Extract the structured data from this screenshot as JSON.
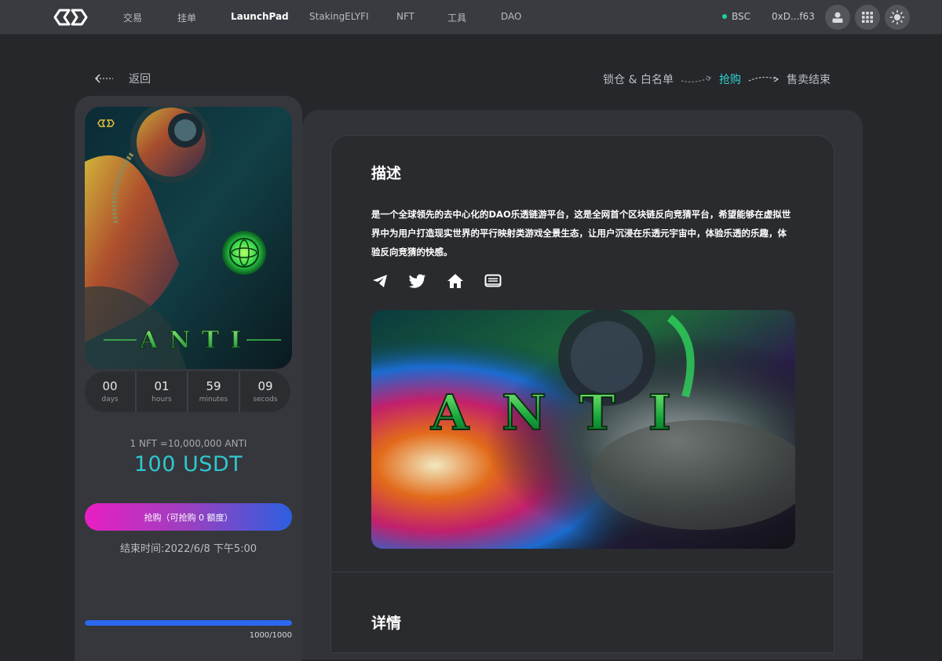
{
  "nav": {
    "items": [
      {
        "label": "交易"
      },
      {
        "label": "挂单"
      },
      {
        "label": "LaunchPad"
      },
      {
        "label": "StakingELYFI"
      },
      {
        "label": "NFT"
      },
      {
        "label": "工具"
      },
      {
        "label": "DAO"
      }
    ],
    "active_label": "LaunchPad",
    "network": "BSC",
    "wallet_address": "0xD...f63",
    "icons": [
      "user-icon",
      "grid-icon",
      "sun-icon"
    ]
  },
  "header": {
    "back_label": "返回",
    "steps": [
      {
        "label": "锁仓 & 白名单",
        "state": "done"
      },
      {
        "label": "抢购",
        "state": "current"
      },
      {
        "label": "售卖结束",
        "state": "upcoming"
      }
    ]
  },
  "sale": {
    "poster_text": "ANTI",
    "countdown": [
      {
        "value": "00",
        "unit": "days"
      },
      {
        "value": "01",
        "unit": "hours"
      },
      {
        "value": "59",
        "unit": "minutes"
      },
      {
        "value": "09",
        "unit": "secods"
      }
    ],
    "rate": "1 NFT =10,000,000 ANTI",
    "price": "100 USDT",
    "buy_label": "抢购（可抢购 0 额度）",
    "end_time": "结束时间:2022/6/8 下午5:00",
    "progress_fraction": 1.0,
    "progress_text": "1000/1000"
  },
  "description": {
    "title": "描述",
    "text": "是一个全球领先的去中心化的DAO乐透链游平台，这是全网首个区块链反向竞猜平台，希望能够在虚拟世界中为用户打造现实世界的平行映射类游戏全景生态，让用户沉浸在乐透元宇宙中，体验乐透的乐趣，体验反向竞猜的快感。",
    "socials": [
      "telegram-icon",
      "twitter-icon",
      "home-icon",
      "book-icon"
    ],
    "banner_text": "ANTI"
  },
  "details": {
    "title": "详情"
  },
  "colors": {
    "accent": "#2fd3d0",
    "price": "#2fc7d0",
    "progress": "#2d68f0",
    "buy_gradient_start": "#e91fc3",
    "buy_gradient_end": "#2c5fe0"
  }
}
